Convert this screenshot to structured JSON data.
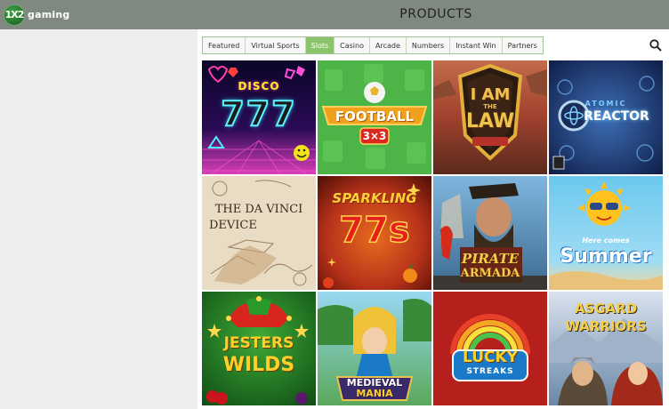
{
  "header": {
    "logo_mark": "1X2",
    "logo_text": "gaming",
    "title": "PRODUCTS"
  },
  "tabs": [
    {
      "label": "Featured",
      "active": false
    },
    {
      "label": "Virtual Sports",
      "active": false
    },
    {
      "label": "Slots",
      "active": true
    },
    {
      "label": "Casino",
      "active": false
    },
    {
      "label": "Arcade",
      "active": false
    },
    {
      "label": "Numbers",
      "active": false
    },
    {
      "label": "Instant Win",
      "active": false
    },
    {
      "label": "Partners",
      "active": false
    }
  ],
  "search_icon": "magnifier-icon",
  "games": [
    {
      "title_line1": "DISCO",
      "title_line2": "777"
    },
    {
      "title_line1": "FOOTBALL",
      "title_line2": "3×3"
    },
    {
      "title_line1": "I AM",
      "title_small": "THE",
      "title_line2": "LAW"
    },
    {
      "title_line1": "ATOMIC",
      "title_line2": "REACTOR"
    },
    {
      "title_line1": "THE DA VINCI",
      "title_line2": "DEVICE"
    },
    {
      "title_line1": "SPARKLING",
      "title_line2": "77s"
    },
    {
      "title_line1": "PIRATE",
      "title_line2": "ARMADA"
    },
    {
      "title_line1": "Here comes",
      "title_line2": "Summer"
    },
    {
      "title_line1": "JESTERS",
      "title_line2": "WILDS"
    },
    {
      "title_line1": "MEDIEVAL",
      "title_line2": "MANIA"
    },
    {
      "title_line1": "LUCKY",
      "title_line2": "STREAKS"
    },
    {
      "title_line1": "ASGARD",
      "title_line2": "WARRIORS"
    }
  ],
  "colors": {
    "topbar": "#808980",
    "active_tab": "#8cc46c",
    "tab_border": "#9fc08f",
    "left_pane": "#eeeeee"
  }
}
